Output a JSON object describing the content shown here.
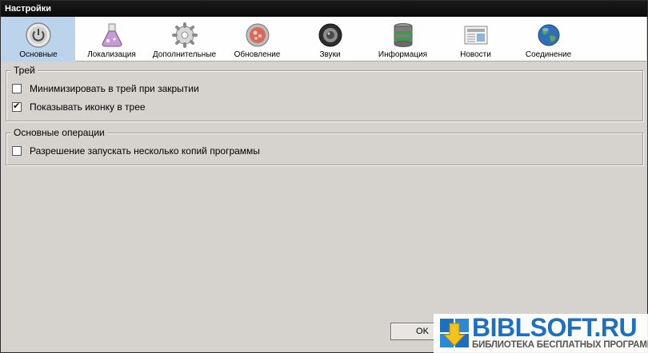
{
  "window": {
    "title": "Настройки"
  },
  "tabs": [
    {
      "label": "Основные",
      "icon": "power-icon",
      "active": true
    },
    {
      "label": "Локализация",
      "icon": "flask-icon",
      "active": false
    },
    {
      "label": "Дополнительные",
      "icon": "gear-icon",
      "active": false
    },
    {
      "label": "Обновление",
      "icon": "refresh-disc-icon",
      "active": false
    },
    {
      "label": "Звуки",
      "icon": "speaker-icon",
      "active": false
    },
    {
      "label": "Информация",
      "icon": "database-icon",
      "active": false
    },
    {
      "label": "Новости",
      "icon": "newspaper-icon",
      "active": false
    },
    {
      "label": "Соединение",
      "icon": "globe-icon",
      "active": false
    }
  ],
  "groups": {
    "tray": {
      "title": "Трей",
      "minimize_label": "Минимизировать в трей при закрытии",
      "minimize_checked": false,
      "show_icon_label": "Показывать иконку в трее",
      "show_icon_checked": true
    },
    "operations": {
      "title": "Основные операции",
      "multi_instance_label": "Разрешение запускать несколько копий программы",
      "multi_instance_checked": false
    }
  },
  "buttons": {
    "ok_label": "OK"
  },
  "watermark": {
    "name": "BIBLSOFT.RU",
    "subtitle": "БИБЛИОТЕКА БЕСПЛАТНЫХ ПРОГРАММ"
  },
  "colors": {
    "active_tab": "#bcd3ec",
    "window_bg": "#d6d3ce",
    "titlebar": "#0a0a0a",
    "watermark_blue": "#1c6fc1"
  }
}
